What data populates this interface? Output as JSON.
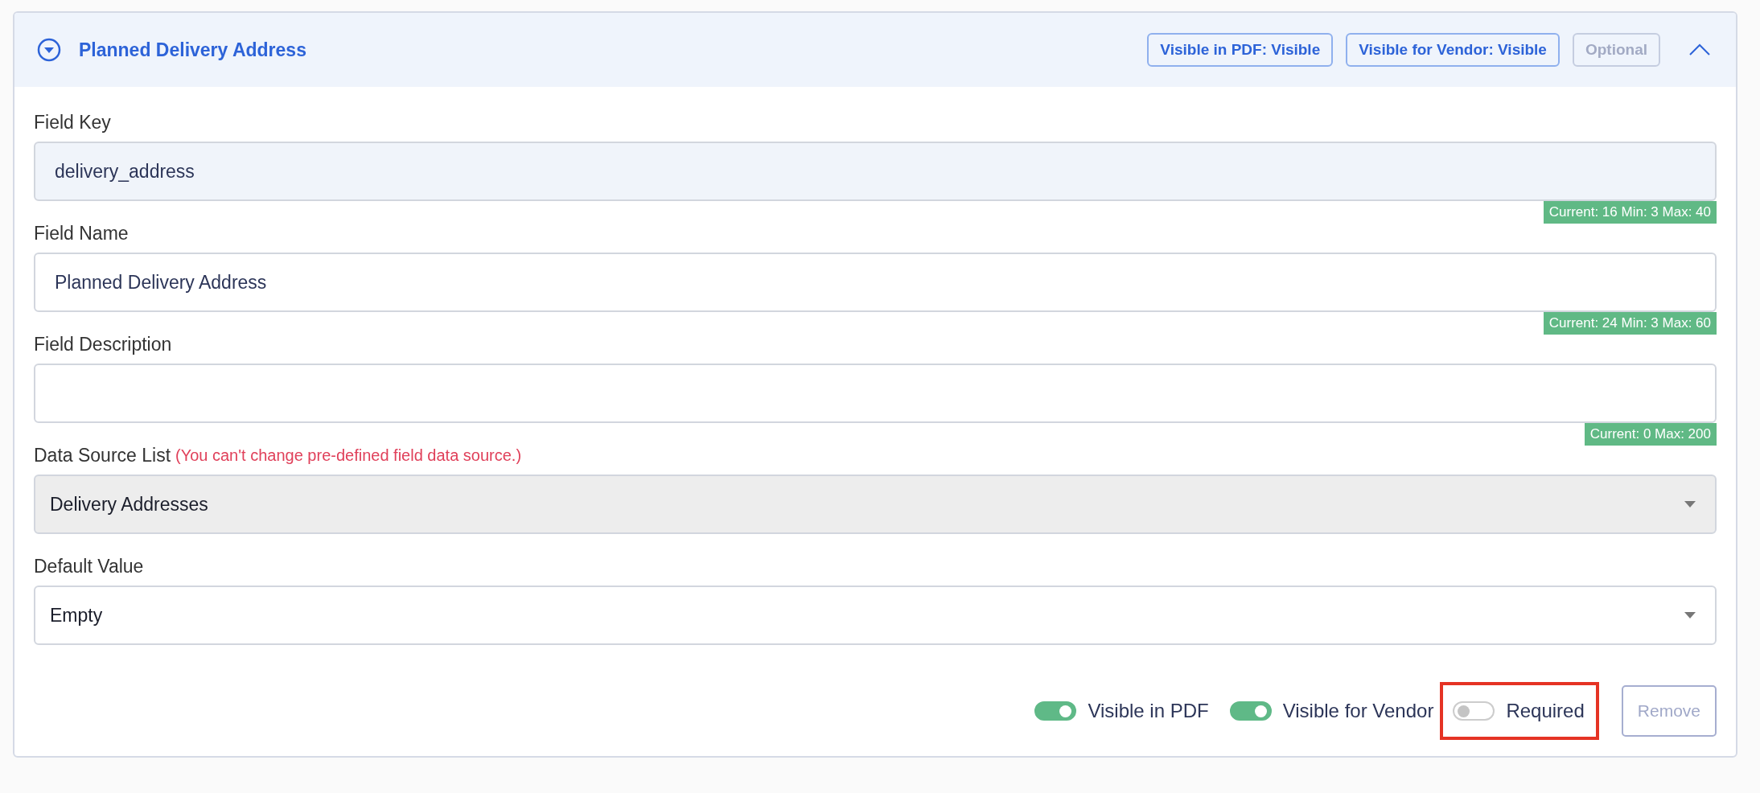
{
  "panel": {
    "title": "Planned Delivery Address",
    "expanded": true,
    "badges": [
      {
        "label": "Visible in PDF: Visible",
        "active": true
      },
      {
        "label": "Visible for Vendor: Visible",
        "active": true
      },
      {
        "label": "Optional",
        "active": false
      }
    ]
  },
  "fields": [
    {
      "kind": "text",
      "label": "Field Key",
      "value": "delivery_address",
      "readonly": true,
      "counter": "Current: 16 Min: 3 Max: 40"
    },
    {
      "kind": "text",
      "label": "Field Name",
      "value": "Planned Delivery Address",
      "readonly": false,
      "counter": "Current: 24 Min: 3 Max: 60"
    },
    {
      "kind": "text",
      "label": "Field Description",
      "readonly": false,
      "counter": "Current: 0 Max: 200"
    },
    {
      "kind": "select",
      "label": "Data Source List",
      "note": "(You can't change pre-defined field data source.)",
      "value": "Delivery Addresses",
      "disabled": true
    },
    {
      "kind": "select",
      "label": "Default Value",
      "value": "Empty",
      "disabled": false
    }
  ],
  "toggles": [
    {
      "label": "Visible in PDF",
      "on": true,
      "highlighted": false
    },
    {
      "label": "Visible for Vendor",
      "on": true,
      "highlighted": false
    },
    {
      "label": "Required",
      "on": false,
      "highlighted": true
    }
  ],
  "remove_button": {
    "label": "Remove",
    "disabled": true
  }
}
